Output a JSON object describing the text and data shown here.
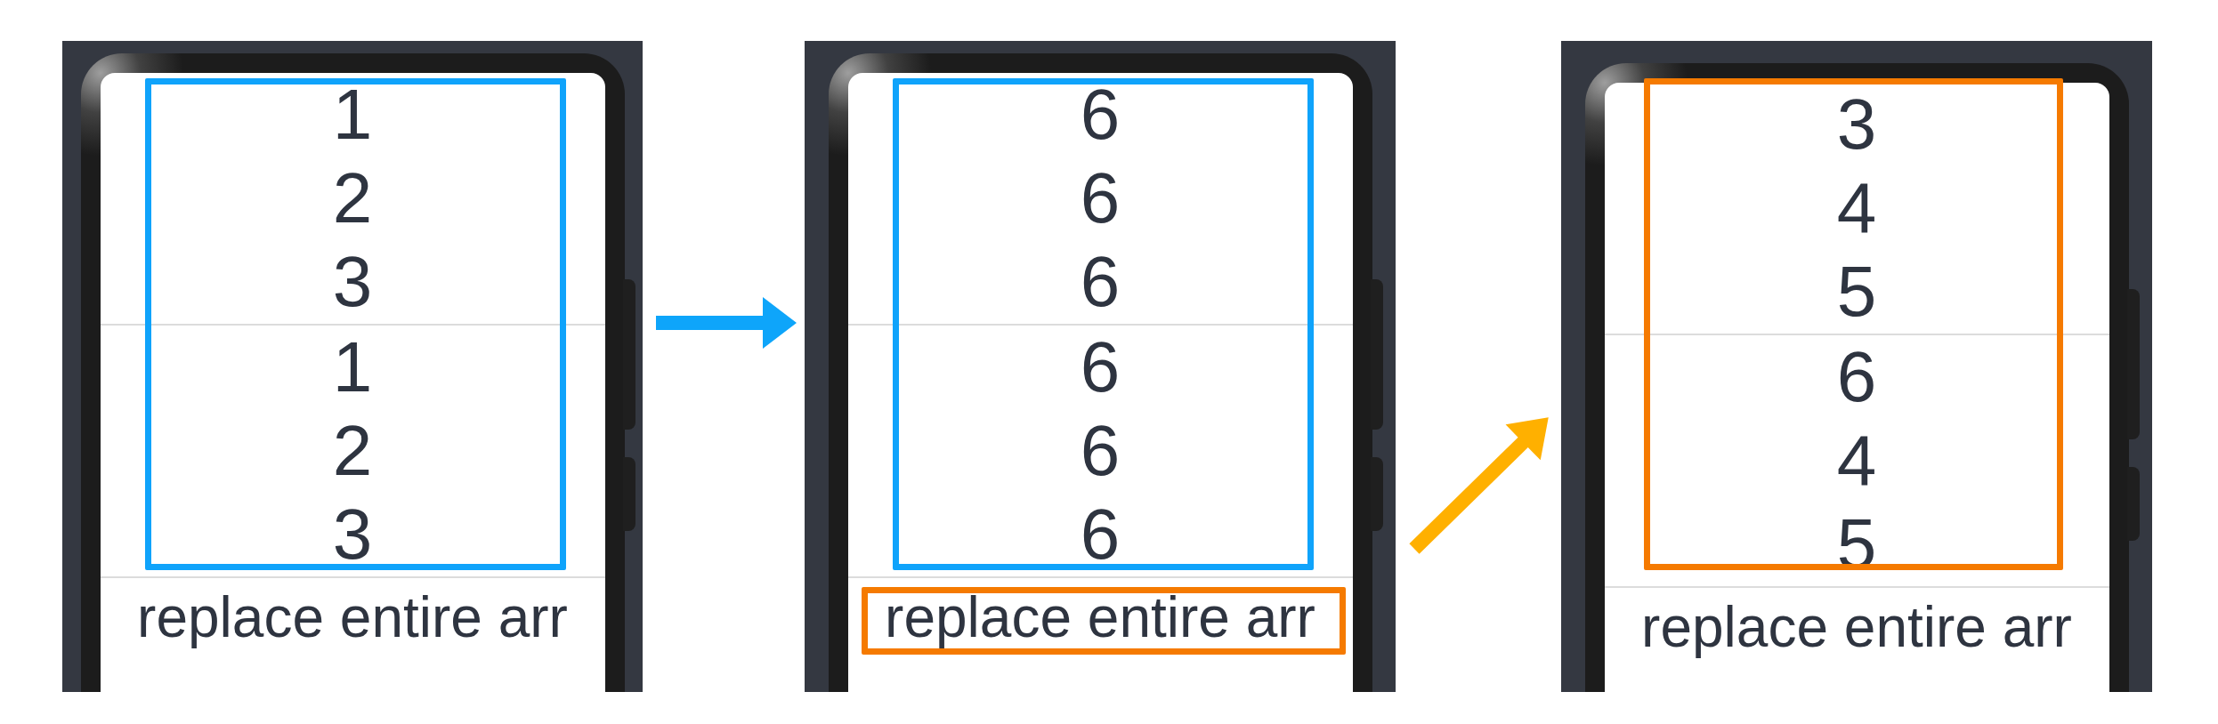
{
  "panels": [
    {
      "groups": [
        {
          "items": [
            "1",
            "2",
            "3"
          ]
        },
        {
          "items": [
            "1",
            "2",
            "3"
          ]
        }
      ],
      "list_highlight": {
        "color": "#0fa3fb"
      },
      "action": {
        "label": "replace entire arr"
      }
    },
    {
      "groups": [
        {
          "items": [
            "6",
            "6",
            "6"
          ]
        },
        {
          "items": [
            "6",
            "6",
            "6"
          ]
        }
      ],
      "list_highlight": {
        "color": "#0fa3fb"
      },
      "action": {
        "label": "replace entire arr",
        "highlight": {
          "color": "#f57a00"
        }
      }
    },
    {
      "groups": [
        {
          "items": [
            "3",
            "4",
            "5"
          ]
        },
        {
          "items": [
            "6",
            "4",
            "5"
          ]
        }
      ],
      "list_highlight": {
        "color": "#f57a00"
      },
      "action": {
        "label": "replace entire arr"
      }
    }
  ],
  "arrows": [
    {
      "kind": "horizontal",
      "color": "#0ea5fa"
    },
    {
      "kind": "diagonal",
      "color": "#ffb000"
    }
  ]
}
